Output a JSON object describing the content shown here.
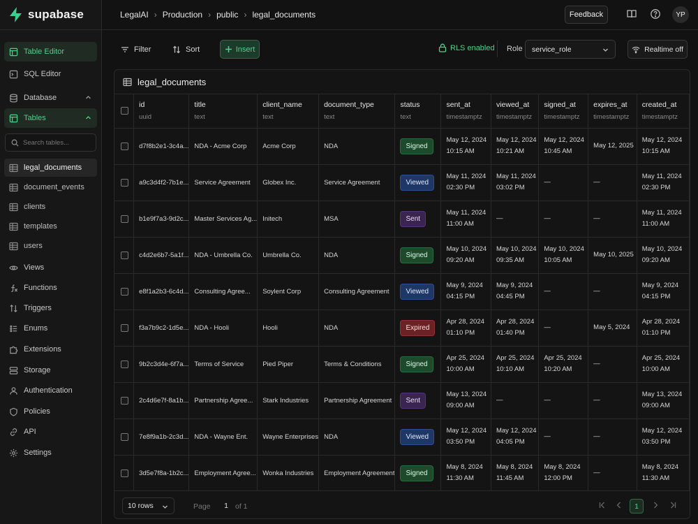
{
  "brand": {
    "name": "supabase",
    "accent": "#3ecf8e"
  },
  "breadcrumb": [
    "LegalAI",
    "Production",
    "public",
    "legal_documents"
  ],
  "topbar": {
    "feedback_label": "Feedback",
    "avatar_initials": "YP"
  },
  "sidebar": {
    "nav_top": [
      {
        "label": "Table Editor",
        "icon": "table-icon"
      },
      {
        "label": "SQL Editor",
        "icon": "terminal-icon"
      },
      {
        "label": "Database",
        "icon": "database-icon"
      },
      {
        "label": "Tables",
        "icon": "table-icon"
      }
    ],
    "search_placeholder": "Search tables...",
    "tables": [
      "legal_documents",
      "document_events",
      "clients",
      "templates",
      "users"
    ],
    "nav_bottom": [
      {
        "label": "Views",
        "icon": "eye-icon"
      },
      {
        "label": "Functions",
        "icon": "function-icon"
      },
      {
        "label": "Triggers",
        "icon": "trigger-icon"
      },
      {
        "label": "Enums",
        "icon": "list-icon"
      },
      {
        "label": "Extensions",
        "icon": "puzzle-icon"
      },
      {
        "label": "Storage",
        "icon": "storage-icon"
      },
      {
        "label": "Authentication",
        "icon": "user-icon"
      },
      {
        "label": "Policies",
        "icon": "shield-icon"
      },
      {
        "label": "API",
        "icon": "link-icon"
      },
      {
        "label": "Settings",
        "icon": "gear-icon"
      }
    ]
  },
  "toolbar": {
    "filter_label": "Filter",
    "sort_label": "Sort",
    "insert_label": "Insert",
    "rls_label": "RLS enabled",
    "role_label": "Role",
    "role_value": "service_role",
    "realtime_label": "Realtime off"
  },
  "table": {
    "title": "legal_documents",
    "columns": [
      {
        "name": "id",
        "type": "uuid"
      },
      {
        "name": "title",
        "type": "text"
      },
      {
        "name": "client_name",
        "type": "text"
      },
      {
        "name": "document_type",
        "type": "text"
      },
      {
        "name": "status",
        "type": "text"
      },
      {
        "name": "sent_at",
        "type": "timestamptz"
      },
      {
        "name": "viewed_at",
        "type": "timestamptz"
      },
      {
        "name": "signed_at",
        "type": "timestamptz"
      },
      {
        "name": "expires_at",
        "type": "timestamptz"
      },
      {
        "name": "created_at",
        "type": "timestamptz"
      }
    ],
    "rows": [
      {
        "id": "d7f8b2e1-3c4a...",
        "title": "NDA - Acme Corp",
        "client_name": "Acme Corp",
        "document_type": "NDA",
        "status": "Signed",
        "sent_at": [
          "May 12, 2024",
          "10:15 AM"
        ],
        "viewed_at": [
          "May 12, 2024",
          "10:21 AM"
        ],
        "signed_at": [
          "May 12, 2024",
          "10:45 AM"
        ],
        "expires_at": [
          "May 12, 2025"
        ],
        "created_at": [
          "May 12, 2024",
          "10:15 AM"
        ]
      },
      {
        "id": "a9c3d4f2-7b1e...",
        "title": "Service Agreement",
        "client_name": "Globex Inc.",
        "document_type": "Service Agreement",
        "status": "Viewed",
        "sent_at": [
          "May 11, 2024",
          "02:30 PM"
        ],
        "viewed_at": [
          "May 11, 2024",
          "03:02 PM"
        ],
        "signed_at": [
          "—"
        ],
        "expires_at": [
          "—"
        ],
        "created_at": [
          "May 11, 2024",
          "02:30 PM"
        ]
      },
      {
        "id": "b1e9f7a3-9d2c...",
        "title": "Master Services Ag...",
        "client_name": "Initech",
        "document_type": "MSA",
        "status": "Sent",
        "sent_at": [
          "May 11, 2024",
          "11:00 AM"
        ],
        "viewed_at": [
          "—"
        ],
        "signed_at": [
          "—"
        ],
        "expires_at": [
          "—"
        ],
        "created_at": [
          "May 11, 2024",
          "11:00 AM"
        ]
      },
      {
        "id": "c4d2e6b7-5a1f...",
        "title": "NDA - Umbrella Co.",
        "client_name": "Umbrella Co.",
        "document_type": "NDA",
        "status": "Signed",
        "sent_at": [
          "May 10, 2024",
          "09:20 AM"
        ],
        "viewed_at": [
          "May 10, 2024",
          "09:35 AM"
        ],
        "signed_at": [
          "May 10, 2024",
          "10:05 AM"
        ],
        "expires_at": [
          "May 10, 2025"
        ],
        "created_at": [
          "May 10, 2024",
          "09:20 AM"
        ]
      },
      {
        "id": "e8f1a2b3-6c4d...",
        "title": "Consulting Agree...",
        "client_name": "Soylent Corp",
        "document_type": "Consulting Agreement",
        "status": "Viewed",
        "sent_at": [
          "May 9, 2024",
          "04:15 PM"
        ],
        "viewed_at": [
          "May 9, 2024",
          "04:45 PM"
        ],
        "signed_at": [
          "—"
        ],
        "expires_at": [
          "—"
        ],
        "created_at": [
          "May 9, 2024",
          "04:15 PM"
        ]
      },
      {
        "id": "f3a7b9c2-1d5e...",
        "title": "NDA - Hooli",
        "client_name": "Hooli",
        "document_type": "NDA",
        "status": "Expired",
        "sent_at": [
          "Apr 28, 2024",
          "01:10 PM"
        ],
        "viewed_at": [
          "Apr 28, 2024",
          "01:40 PM"
        ],
        "signed_at": [
          "—"
        ],
        "expires_at": [
          "May 5, 2024"
        ],
        "created_at": [
          "Apr 28, 2024",
          "01:10 PM"
        ]
      },
      {
        "id": "9b2c3d4e-6f7a...",
        "title": "Terms of Service",
        "client_name": "Pied Piper",
        "document_type": "Terms & Conditions",
        "status": "Signed",
        "sent_at": [
          "Apr 25, 2024",
          "10:00 AM"
        ],
        "viewed_at": [
          "Apr 25, 2024",
          "10:10 AM"
        ],
        "signed_at": [
          "Apr 25, 2024",
          "10:20 AM"
        ],
        "expires_at": [
          "—"
        ],
        "created_at": [
          "Apr 25, 2024",
          "10:00 AM"
        ]
      },
      {
        "id": "2c4d6e7f-8a1b...",
        "title": "Partnership Agree...",
        "client_name": "Stark Industries",
        "document_type": "Partnership Agreement",
        "status": "Sent",
        "sent_at": [
          "May 13, 2024",
          "09:00 AM"
        ],
        "viewed_at": [
          "—"
        ],
        "signed_at": [
          "—"
        ],
        "expires_at": [
          "—"
        ],
        "created_at": [
          "May 13, 2024",
          "09:00 AM"
        ]
      },
      {
        "id": "7e8f9a1b-2c3d...",
        "title": "NDA - Wayne Ent.",
        "client_name": "Wayne Enterprises",
        "document_type": "NDA",
        "status": "Viewed",
        "sent_at": [
          "May 12, 2024",
          "03:50 PM"
        ],
        "viewed_at": [
          "May 12, 2024",
          "04:05 PM"
        ],
        "signed_at": [
          "—"
        ],
        "expires_at": [
          "—"
        ],
        "created_at": [
          "May 12, 2024",
          "03:50 PM"
        ]
      },
      {
        "id": "3d5e7f8a-1b2c...",
        "title": "Employment Agree...",
        "client_name": "Wonka Industries",
        "document_type": "Employment Agreement",
        "status": "Signed",
        "sent_at": [
          "May 8, 2024",
          "11:30 AM"
        ],
        "viewed_at": [
          "May 8, 2024",
          "11:45 AM"
        ],
        "signed_at": [
          "May 8, 2024",
          "12:00 PM"
        ],
        "expires_at": [
          "—"
        ],
        "created_at": [
          "May 8, 2024",
          "11:30 AM"
        ]
      }
    ]
  },
  "status_colors": {
    "Signed": "#1c4a2b",
    "Viewed": "#1e3766",
    "Sent": "#3a2450",
    "Expired": "#6b2224"
  },
  "pagination": {
    "rows_label": "10 rows",
    "page_label": "Page",
    "page_value": "1",
    "of_label": "of 1",
    "current_page": "1"
  }
}
